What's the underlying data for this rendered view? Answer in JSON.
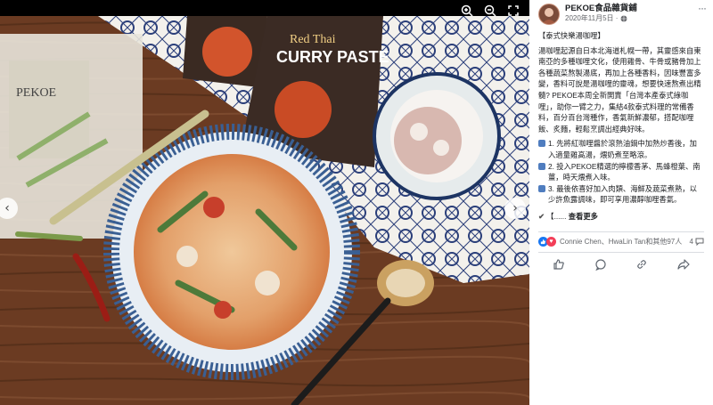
{
  "viewer": {
    "icons": [
      "zoom-in-icon",
      "zoom-out-icon",
      "fullscreen-icon"
    ]
  },
  "post": {
    "page_name": "PEKOE食品雜貨鋪",
    "date": "2020年11月5日 ·",
    "heading": "【泰式快樂湯咖哩】",
    "paragraph": "湯咖哩起源自日本北海道札幌一帶，其靈感來自東南亞的多種咖哩文化，使用雞骨、牛骨或豬骨加上各種蔬菜熬製湯底，再加上各種香料，因味豐富多變，香料可說是湯咖哩的靈魂，想要快速熬煮出精髓? PEKOE本周全新開賣「台灣本產泰式綠咖哩」，助你一臂之力，集結4款泰式料理的常備香料，百分百台灣種作，香氣新鮮濃郁，搭配咖哩飯、炙麵，輕鬆烹調出經典好味。",
    "steps": [
      "1. 先將紅咖哩醬於滾熱油鍋中加熱炒香後，加入適量雞高湯，煨奶煮至略滾。",
      "2. 投入PEKOE精選的檸檬香茅、馬蜂橙葉、南薑，時天煨煮入味。",
      "3. 最後依喜好加入肉類、海鮮及蔬菜煮熟，以少許魚露調味，即可享用濃醇咖哩香氣。"
    ],
    "see_more_prefix": "【......",
    "see_more": "查看更多",
    "reactions_text": "Connie Chen、HwaLin Tan和其他97人",
    "comment_count": "4"
  },
  "colors": {
    "accent": "#1877f2",
    "love": "#f33e58"
  }
}
